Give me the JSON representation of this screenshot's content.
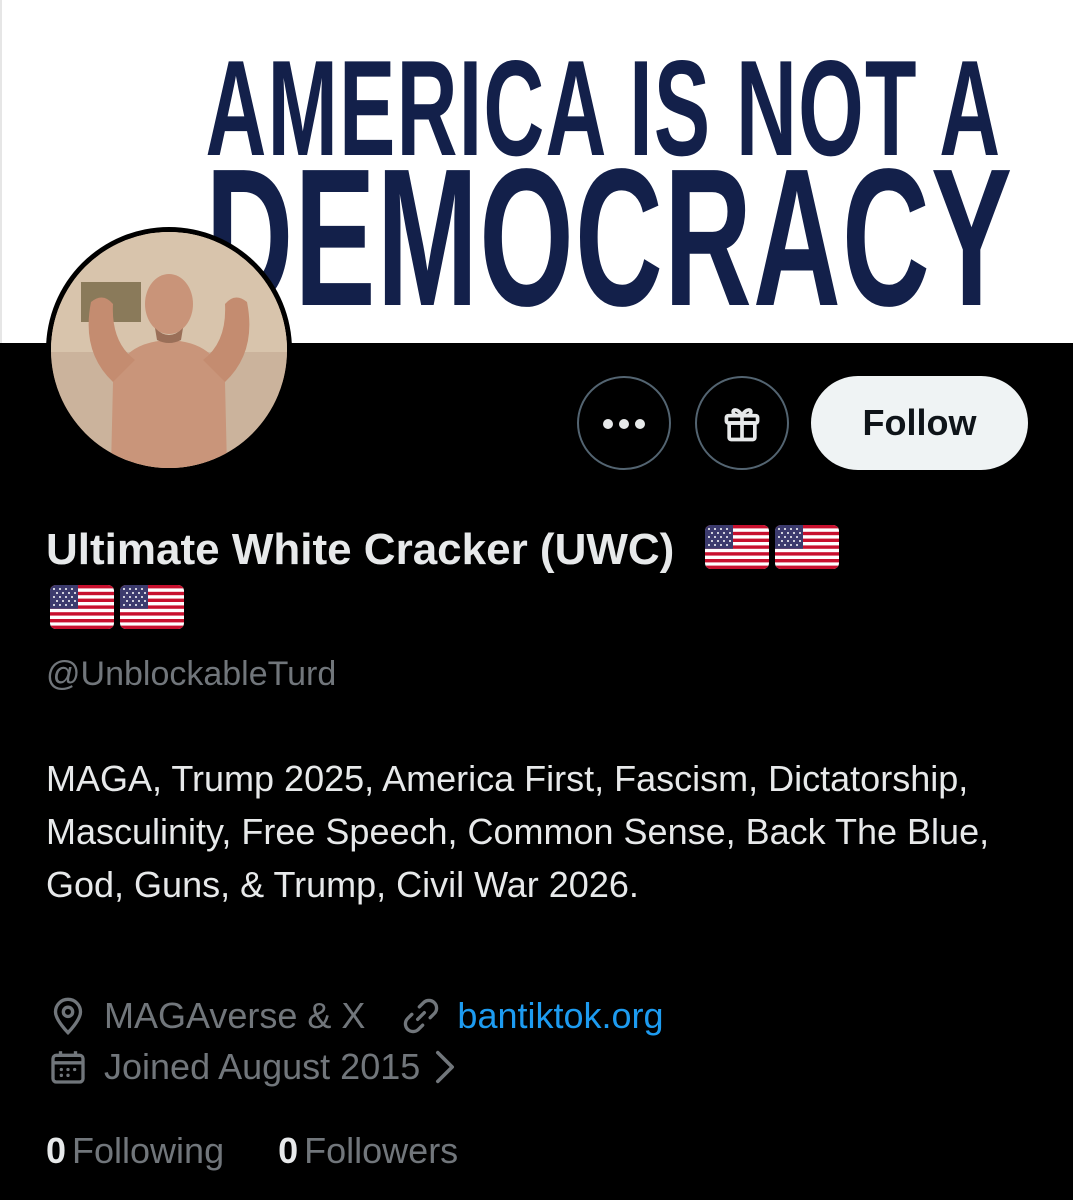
{
  "banner": {
    "line1": "AMERICA IS NOT A",
    "line2": "DEMOCRACY",
    "text_color": "#13204a",
    "background": "#ffffff"
  },
  "actions": {
    "more_icon": "more-icon",
    "gift_icon": "gift-icon",
    "follow_label": "Follow"
  },
  "profile": {
    "display_name": "Ultimate White Cracker (UWC)",
    "name_emoji": [
      "us-flag",
      "us-flag",
      "us-flag",
      "us-flag"
    ],
    "handle": "@UnblockableTurd",
    "bio": "MAGA, Trump 2025, America First, Fascism, Dictatorship, Masculinity, Free Speech, Common Sense, Back The Blue, God, Guns, & Trump, Civil War 2026.",
    "location": "MAGAverse & X",
    "website": "bantiktok.org",
    "joined": "Joined August 2015"
  },
  "stats": {
    "following_count": "0",
    "following_label": "Following",
    "followers_count": "0",
    "followers_label": "Followers"
  },
  "colors": {
    "background": "#000000",
    "primary_text": "#e7e9ea",
    "secondary_text": "#71767b",
    "link": "#1d9bf0",
    "follow_button_bg": "#eff3f4"
  }
}
